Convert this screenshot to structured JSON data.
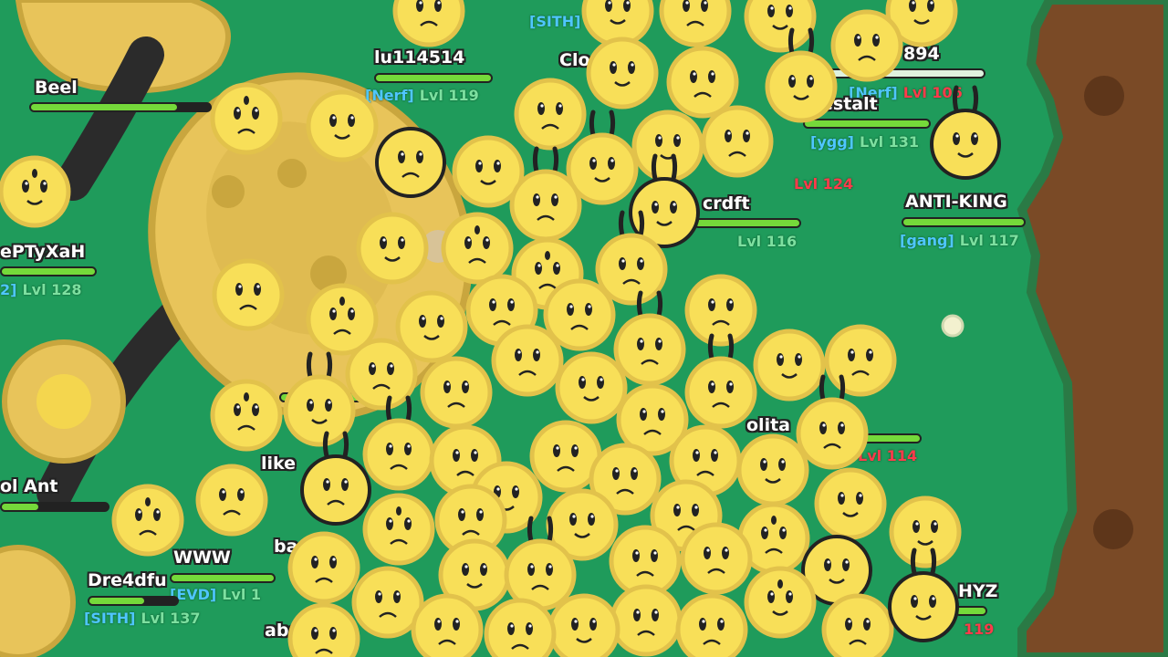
{
  "game": {
    "colors": {
      "grass": "#1f9b5b",
      "dirt": "#7a4a26",
      "dirt_edge": "#2a7a45",
      "bee": "#f8df58",
      "bee_outline": "#e2c24b",
      "hp_bar": "#75d93a",
      "clan": "#4fc6ff",
      "level": "#7de0a0",
      "level_hostile": "#ff3b4b"
    },
    "players": [
      {
        "name": "lu114514",
        "clan": "",
        "level": ""
      },
      {
        "name": "Beel",
        "clan": "",
        "level": ""
      },
      {
        "name": "ePTyXaH",
        "clan": "2]",
        "level": "Lvl 128"
      },
      {
        "name": "ANTI-KING",
        "clan": "[gang]",
        "level": "Lvl 117"
      },
      {
        "name": "WWW",
        "clan": "[EVD]",
        "level": "Lvl 1"
      },
      {
        "name": "Dre4dfu",
        "clan": "[SITH]",
        "level": "Lvl 137"
      },
      {
        "name": "HYZ",
        "clan": "",
        "level": "119"
      },
      {
        "name": "olita",
        "clan": "",
        "level": "Lvl 114"
      },
      {
        "name": "like",
        "clan": "",
        "level": ""
      },
      {
        "name": "ol Ant",
        "clan": "",
        "level": ""
      },
      {
        "name": "894",
        "clan": "[Nerf]",
        "level": "Lvl 106"
      },
      {
        "name": "estalt",
        "clan": "[ygg]",
        "level": "Lvl 131"
      },
      {
        "name": "crdft",
        "clan": "",
        "level": "Lvl 116"
      },
      {
        "name": "Clo",
        "clan": "[SITH]",
        "level": ""
      },
      {
        "name": "",
        "clan": "[Nerf]",
        "level": "Lvl 119"
      },
      {
        "name": "",
        "clan": "",
        "level": "Lvl 124"
      },
      {
        "name": "abo",
        "clan": "",
        "level": ""
      },
      {
        "name": "ba",
        "clan": "",
        "level": ""
      }
    ]
  }
}
